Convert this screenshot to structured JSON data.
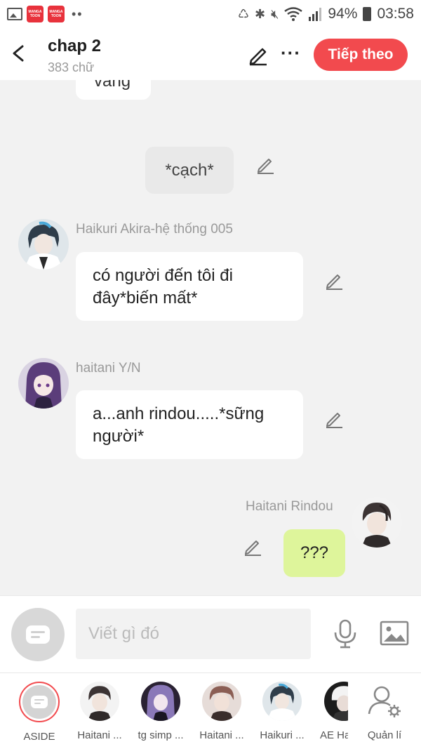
{
  "status_bar": {
    "app_icon_1_text": "MANGA TOON",
    "app_icon_2_text": "MANGA TOON",
    "more_indicator": "••",
    "battery": "94%",
    "time": "03:58"
  },
  "header": {
    "title": "chap 2",
    "subtitle": "383 chữ",
    "more_label": "···",
    "next_label": "Tiếp theo"
  },
  "chat": {
    "partial_text": "vàng",
    "narration": "*cạch*",
    "messages": [
      {
        "sender": "Haikuri Akira-hệ thống 005",
        "text": "có người đến tôi đi đây*biến mất*"
      },
      {
        "sender": "haitani Y/N",
        "text": "a...anh rindou.....*sững người*"
      },
      {
        "sender": "Haitani Rindou",
        "text": "???"
      }
    ]
  },
  "input": {
    "placeholder": "Viết gì đó"
  },
  "characters": [
    {
      "label": "ASIDE"
    },
    {
      "label": "Haitani ..."
    },
    {
      "label": "tg simp ..."
    },
    {
      "label": "Haitani ..."
    },
    {
      "label": "Haikuri ..."
    },
    {
      "label": "AE Ha"
    },
    {
      "label": "Quản lí"
    }
  ],
  "colors": {
    "accent": "#f24a4e",
    "self_bubble": "#def59b",
    "background": "#f2f2f2"
  }
}
